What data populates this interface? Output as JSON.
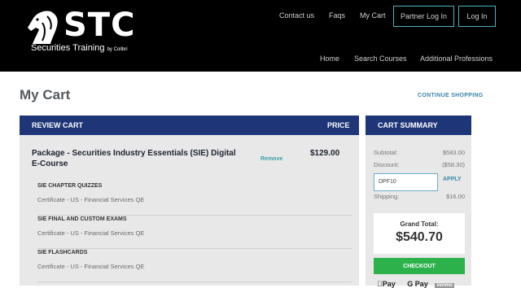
{
  "brand": {
    "name": "STC",
    "tagline": "Securities Training",
    "by": "by Colibri"
  },
  "topnav": {
    "contact": "Contact us",
    "faqs": "Faqs",
    "cart": "My Cart",
    "partner_login": "Partner Log In",
    "login": "Log In"
  },
  "subnav": {
    "home": "Home",
    "search": "Search Courses",
    "additional": "Additional Professions"
  },
  "page": {
    "title": "My Cart",
    "continue": "CONTINUE SHOPPING"
  },
  "review": {
    "header": "REVIEW CART",
    "price_header": "PRICE",
    "package": {
      "title": "Package - Securities Industry Essentials (SIE) Digital E-Course",
      "remove": "Remove",
      "price": "$129.00"
    },
    "items": [
      {
        "title": "SIE CHAPTER QUIZZES",
        "desc": "Certificate - US - Financial Services QE"
      },
      {
        "title": "SIE FINAL AND CUSTOM EXAMS",
        "desc": "Certificate - US - Financial Services QE"
      },
      {
        "title": "SIE FLASHCARDS",
        "desc": "Certificate - US - Financial Services QE"
      }
    ]
  },
  "summary": {
    "header": "CART SUMMARY",
    "subtotal_label": "Subtotal:",
    "subtotal": "$583.00",
    "discount_label": "Discount:",
    "discount": "($58.30)",
    "promo_value": "DPF10",
    "apply": "APPLY",
    "shipping_label": "Shipping:",
    "shipping": "$16.00",
    "grand_total_label": "Grand Total:",
    "grand_total": "$540.70",
    "checkout": "CHECKOUT",
    "pay_apple": "Pay",
    "pay_google": "G Pay",
    "pay_venmo": "venmo"
  },
  "colors": {
    "header_bg": "#000000",
    "bar_bg": "#1e3577",
    "accent": "#3a86a8",
    "checkout": "#2db14a"
  },
  "icons": [
    "stc-logo-horse-icon",
    "apple-pay-icon",
    "google-pay-icon"
  ]
}
